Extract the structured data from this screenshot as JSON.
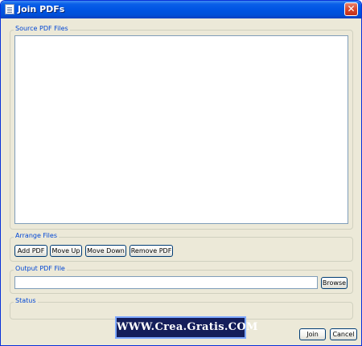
{
  "window": {
    "title": "Join PDFs",
    "close_glyph": "✕"
  },
  "source_group": {
    "label": "Source PDF Files",
    "files": []
  },
  "arrange_group": {
    "label": "Arrange Files",
    "buttons": [
      "Add PDF",
      "Move Up",
      "Move Down",
      "Remove PDF"
    ]
  },
  "output_group": {
    "label": "Output PDF File",
    "value": "",
    "browse_label": "Browse"
  },
  "status_group": {
    "label": "Status",
    "text": ""
  },
  "footer": {
    "join_label": "Join",
    "cancel_label": "Cancel"
  },
  "watermark": {
    "text": "WWW.Crea.Gratis.COM"
  },
  "icons": {
    "app": "document-icon",
    "close": "close-icon"
  },
  "colors": {
    "titlebar": "#0054e3",
    "window_bg": "#ece9d8",
    "group_label": "#0046d5",
    "close_button": "#d9472b"
  }
}
